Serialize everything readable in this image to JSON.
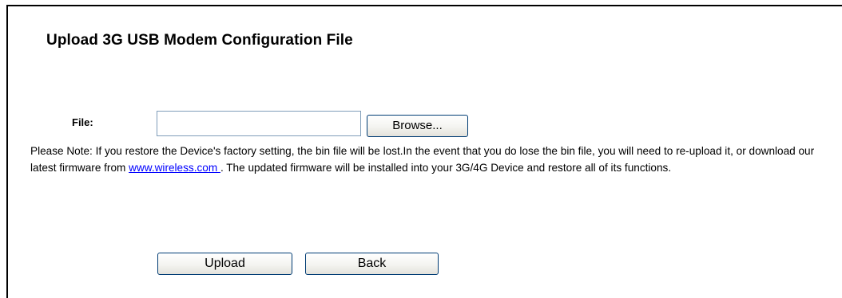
{
  "page": {
    "title": "Upload 3G USB Modem Configuration File"
  },
  "file": {
    "label": "File:",
    "value": "",
    "browse_label": "Browse..."
  },
  "note": {
    "text_before_link": "Please Note: If you restore the Device's factory setting, the bin file will be lost.In the event that you do lose the bin file, you will need to re-upload it, or download our latest firmware from ",
    "link_text": "www.wireless.com ",
    "text_after_link": ". The updated firmware will be installed into your 3G/4G Device and restore all of its functions."
  },
  "actions": {
    "upload_label": "Upload",
    "back_label": "Back"
  }
}
